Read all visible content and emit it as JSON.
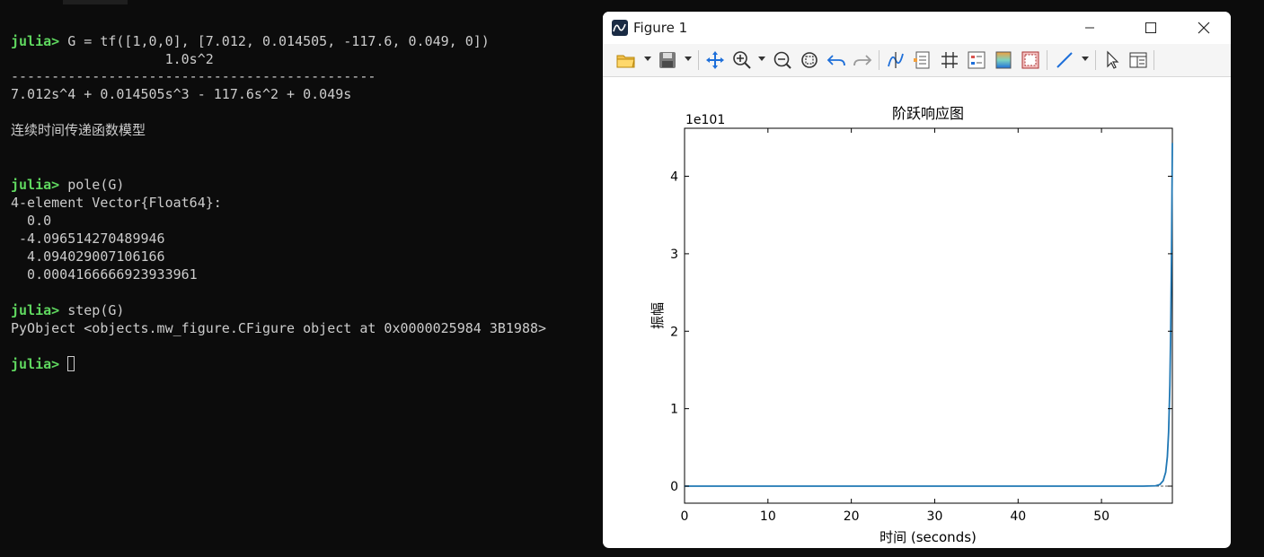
{
  "terminal": {
    "lines": [
      {
        "prompt": "julia>",
        "text": " G = tf([1,0,0], [7.012, 0.014505, -117.6, 0.049, 0])"
      },
      {
        "text": "                   1.0s^2"
      },
      {
        "text": "---------------------------------------------"
      },
      {
        "text": "7.012s^4 + 0.014505s^3 - 117.6s^2 + 0.049s"
      },
      {
        "text": "连续时间传递函数模型"
      },
      {
        "prompt": "julia>",
        "text": " pole(G)"
      },
      {
        "text": "4-element Vector{Float64}:"
      },
      {
        "text": "  0.0"
      },
      {
        "text": " -4.096514270489946"
      },
      {
        "text": "  4.094029007106166"
      },
      {
        "text": "  0.0004166666923933961"
      },
      {
        "prompt": "julia>",
        "text": " step(G)"
      },
      {
        "text": "PyObject <objects.mw_figure.CFigure object at 0x0000025984 3B1988>"
      },
      {
        "prompt": "julia>",
        "text": " "
      }
    ]
  },
  "figure_window": {
    "title": "Figure 1",
    "toolbar_icons": [
      "open-folder-icon",
      "save-icon",
      "pan-icon",
      "zoom-in-icon",
      "zoom-out-icon",
      "zoom-fit-icon",
      "undo-icon",
      "redo-icon",
      "data-cursor-icon",
      "legend-icon",
      "grid-icon",
      "property-icon",
      "colorbar-icon",
      "frame-icon",
      "line-tool-icon",
      "select-arrow-icon",
      "panel-icon"
    ]
  },
  "colors": {
    "terminal_bg": "#0c0c0c",
    "terminal_text": "#cccccc",
    "prompt": "#5fd75f",
    "line": "#1f77b4"
  },
  "chart_data": {
    "type": "line",
    "title": "阶跃响应图",
    "xlabel": "时间 (seconds)",
    "ylabel": "振幅",
    "y_multiplier_label": "1e101",
    "xlim": [
      0,
      58.5
    ],
    "ylim": [
      -0.22,
      4.62
    ],
    "xticks": [
      0,
      10,
      20,
      30,
      40,
      50
    ],
    "yticks": [
      0,
      1,
      2,
      3,
      4
    ],
    "grid": false,
    "reference_line": {
      "y": 0,
      "style": "dashed"
    },
    "series": [
      {
        "color": "#1f77b4",
        "x": [
          0,
          10,
          20,
          30,
          40,
          50,
          55,
          56.5,
          57.0,
          57.4,
          57.7,
          57.9,
          58.05,
          58.2,
          58.3,
          58.4,
          58.45,
          58.5
        ],
        "y": [
          0,
          0,
          0,
          0,
          0,
          0,
          0,
          0.004,
          0.02,
          0.07,
          0.18,
          0.38,
          0.7,
          1.3,
          2.0,
          3.0,
          3.7,
          4.43
        ]
      }
    ]
  }
}
